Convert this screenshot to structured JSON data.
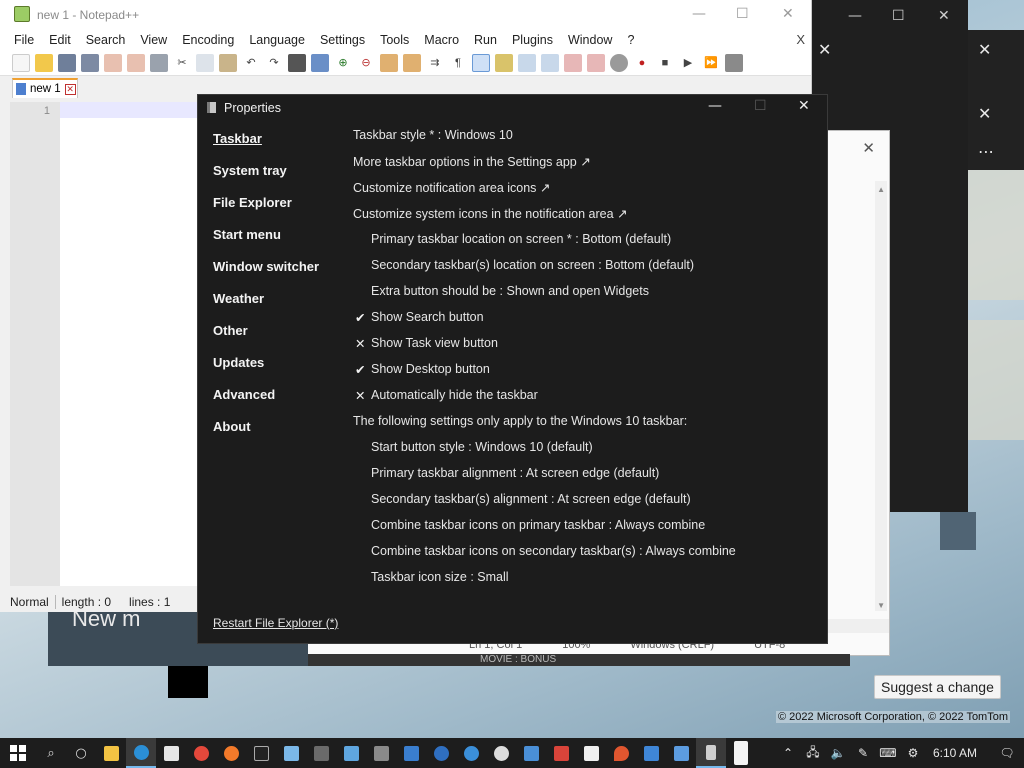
{
  "notepad": {
    "title": "new 1 - Notepad++",
    "menu": [
      "File",
      "Edit",
      "Search",
      "View",
      "Encoding",
      "Language",
      "Settings",
      "Tools",
      "Macro",
      "Run",
      "Plugins",
      "Window",
      "?"
    ],
    "menu_close": "X",
    "tab_label": "new 1",
    "line_number": "1",
    "status": {
      "mode": "Normal",
      "length": "length : 0",
      "lines": "lines : 1"
    }
  },
  "properties": {
    "title": "Properties",
    "nav": [
      "Taskbar",
      "System tray",
      "File Explorer",
      "Start menu",
      "Window switcher",
      "Weather",
      "Other",
      "Updates",
      "Advanced",
      "About"
    ],
    "options": [
      {
        "text": "Taskbar style * : Windows 10",
        "indent": 0,
        "mark": ""
      },
      {
        "text": "More taskbar options in the Settings app ↗",
        "indent": 0,
        "mark": ""
      },
      {
        "text": "Customize notification area icons ↗",
        "indent": 0,
        "mark": ""
      },
      {
        "text": "Customize system icons in the notification area ↗",
        "indent": 0,
        "mark": ""
      },
      {
        "text": "Primary taskbar location on screen * : Bottom (default)",
        "indent": 1,
        "mark": ""
      },
      {
        "text": "Secondary taskbar(s) location on screen : Bottom (default)",
        "indent": 1,
        "mark": ""
      },
      {
        "text": "Extra button should be : Shown and open Widgets",
        "indent": 1,
        "mark": ""
      },
      {
        "text": "Show Search button",
        "indent": 1,
        "mark": "✔"
      },
      {
        "text": "Show Task view button",
        "indent": 1,
        "mark": "✕"
      },
      {
        "text": "Show Desktop button",
        "indent": 1,
        "mark": "✔"
      },
      {
        "text": "Automatically hide the taskbar",
        "indent": 1,
        "mark": "✕"
      },
      {
        "text": "The following settings only apply to the Windows 10 taskbar:",
        "indent": 0,
        "mark": ""
      },
      {
        "text": "Start button style : Windows 10 (default)",
        "indent": 1,
        "mark": ""
      },
      {
        "text": "Primary taskbar alignment : At screen edge (default)",
        "indent": 1,
        "mark": ""
      },
      {
        "text": "Secondary taskbar(s) alignment : At screen edge (default)",
        "indent": 1,
        "mark": ""
      },
      {
        "text": "Combine taskbar icons on primary taskbar : Always combine",
        "indent": 1,
        "mark": ""
      },
      {
        "text": "Combine taskbar icons on secondary taskbar(s) : Always combine",
        "indent": 1,
        "mark": ""
      },
      {
        "text": "Taskbar icon size : Small",
        "indent": 1,
        "mark": ""
      }
    ],
    "restart_link": "Restart File Explorer (*)"
  },
  "background": {
    "new_m": "New m",
    "suggest_button": "Suggest a change",
    "copyright": "© 2022 Microsoft Corporation, © 2022 TomTom",
    "edge_status": [
      "Ln 1, Col 1",
      "100%",
      "Windows (CRLF)",
      "UTF-8"
    ],
    "movie_strip": "MOVIE : BONUS"
  },
  "taskbar": {
    "clock": "6:10 AM"
  },
  "colors": {
    "dialog_bg": "#1c1c1c",
    "taskbar_bg": "#1d1d1d",
    "tab_accent": "#f0a030"
  }
}
